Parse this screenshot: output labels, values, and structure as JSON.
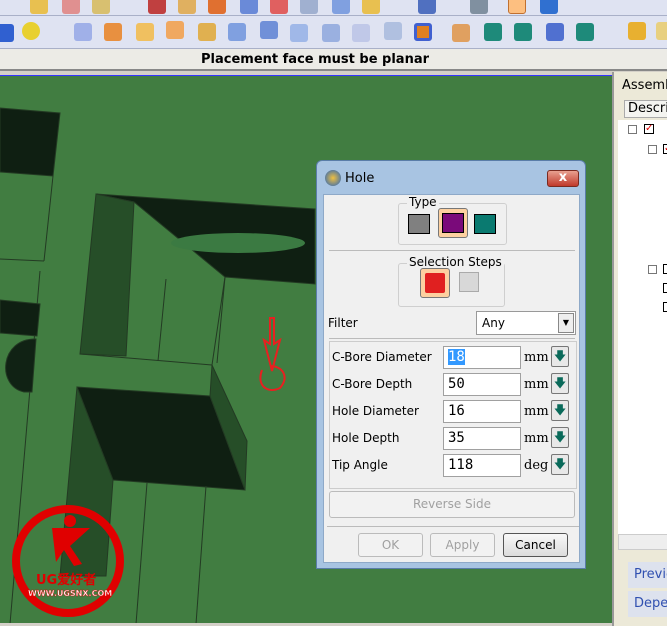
{
  "status": {
    "message": "Placement face must be planar"
  },
  "right_panel": {
    "title": "Assemb",
    "column": "Descrip",
    "buttons": [
      "Previe",
      "Deper"
    ]
  },
  "dialog": {
    "title": "Hole",
    "close_label": "x",
    "type_group": "Type",
    "type_options": [
      "simple-hole",
      "counterbore-hole",
      "countersink-hole"
    ],
    "selected_type": "counterbore-hole",
    "steps_group": "Selection Steps",
    "filter_label": "Filter",
    "filter_value": "Any",
    "params": [
      {
        "label": "C-Bore Diameter",
        "value": "18",
        "unit": "mm"
      },
      {
        "label": "C-Bore Depth",
        "value": "50",
        "unit": "mm"
      },
      {
        "label": "Hole Diameter",
        "value": "16",
        "unit": "mm"
      },
      {
        "label": "Hole Depth",
        "value": "35",
        "unit": "mm"
      },
      {
        "label": "Tip Angle",
        "value": "118",
        "unit": "deg"
      }
    ],
    "reverse_side": "Reverse Side",
    "ok": "OK",
    "apply": "Apply",
    "cancel": "Cancel"
  },
  "watermark": {
    "text": "UG爱好者",
    "url": "WWW.UGSNX.COM"
  },
  "colors": {
    "viewport": "#417d41",
    "accent_selected": "#fdd0a0",
    "annotation": "#e82020"
  }
}
